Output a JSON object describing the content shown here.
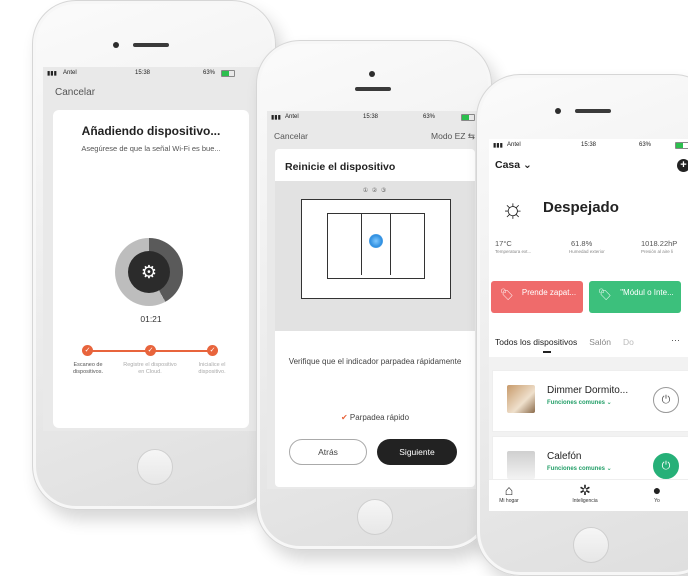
{
  "phone1": {
    "status": {
      "carrier": "Antel",
      "time": "15:38",
      "battery": "63%"
    },
    "cancel_label": "Cancelar",
    "title": "Añadiendo dispositivo...",
    "subtitle": "Asegúrese de que la señal Wi-Fi es bue...",
    "timer": "01:21",
    "progress": 0.42,
    "steps": [
      {
        "label": "Escaneo de dispositivos.",
        "done": true
      },
      {
        "label": "Registre el dispositivo en Cloud.",
        "done": true
      },
      {
        "label": "Inicialice el dispositivo.",
        "done": true
      }
    ]
  },
  "phone2": {
    "status": {
      "carrier": "Antel",
      "time": "15:38",
      "battery": "63%"
    },
    "cancel_label": "Cancelar",
    "mode_label": "Modo EZ ⇆",
    "title": "Reinicie el dispositivo",
    "step_indicator": "① ② ③",
    "verify_text": "Verifique que el indicador parpadea rápidamente",
    "check_label": "Parpadea rápido",
    "back_label": "Atrás",
    "next_label": "Siguiente"
  },
  "phone3": {
    "status": {
      "carrier": "Antel",
      "time": "15:38",
      "battery": "63%"
    },
    "home_label": "Casa ⌄",
    "weather": "Despejado",
    "temp": {
      "value": "17°C",
      "label": "Temperatura ext..."
    },
    "humidity": {
      "value": "61.8%",
      "label": "Humedad exterior"
    },
    "pressure": {
      "value": "1018.22hP",
      "label": "Presión al aire li"
    },
    "scenes": [
      {
        "label": "Prende zapat...",
        "color": "#ef6b6b"
      },
      {
        "label": "\"Módul o Inte...",
        "color": "#3cc07c"
      }
    ],
    "tabs": [
      "Todos los dispositivos",
      "Salón",
      "Do"
    ],
    "devices": [
      {
        "name": "Dimmer Dormito...",
        "sub": "Funciones comunes ⌄",
        "on": false
      },
      {
        "name": "Calefón",
        "sub": "Funciones comunes ⌄",
        "on": true
      }
    ],
    "nav": [
      {
        "label": "Mi hogar",
        "icon": "home-icon"
      },
      {
        "label": "Inteligencia",
        "icon": "scene-icon"
      },
      {
        "label": "Yo",
        "icon": "user-icon"
      }
    ]
  }
}
